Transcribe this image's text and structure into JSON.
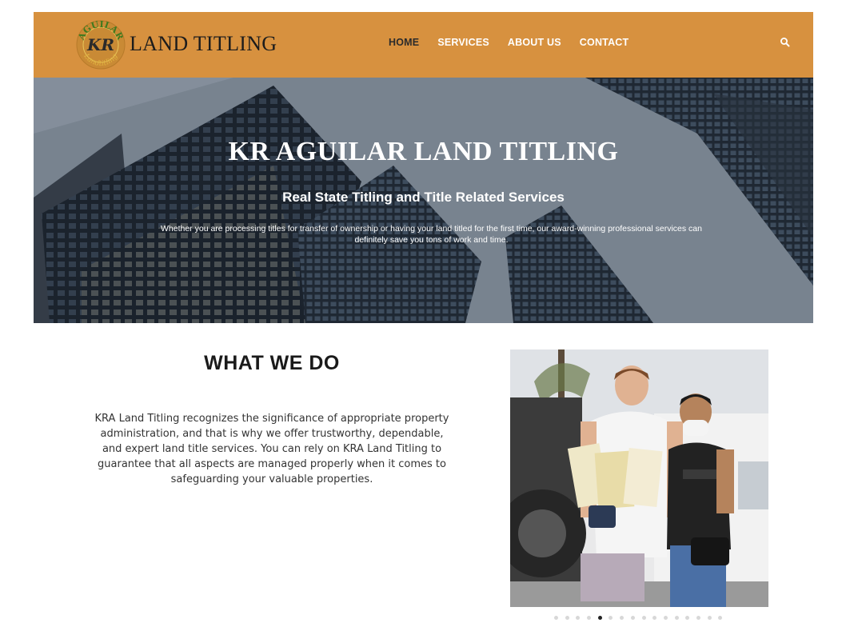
{
  "header": {
    "logo_text_top": "AGUILAR",
    "logo_monogram": "KR",
    "logo_text_bottom": "Landtitling",
    "brand": "LAND TITLING",
    "nav": [
      {
        "label": "HOME",
        "active": true
      },
      {
        "label": "SERVICES",
        "active": false
      },
      {
        "label": "ABOUT US",
        "active": false
      },
      {
        "label": "CONTACT",
        "active": false
      }
    ],
    "search_icon": "search-icon",
    "background_color": "#d7913f"
  },
  "hero": {
    "title": "KR AGUILAR LAND TITLING",
    "subtitle": "Real State Titling and Title Related Services",
    "body": "Whether you are processing titles for transfer of ownership or having your land titled for the first time, our award-winning professional services can definitely save you tons of work and time."
  },
  "what_we_do": {
    "title": "WHAT WE DO",
    "body": "KRA Land Titling recognizes the significance of appropriate property administration, and that is why we offer trustworthy, dependable, and expert land title services. You can rely on KRA Land Titling to guarantee that all aspects are managed properly when it comes to safeguarding your valuable properties."
  },
  "carousel": {
    "slide_count": 16,
    "active_index": 4
  }
}
